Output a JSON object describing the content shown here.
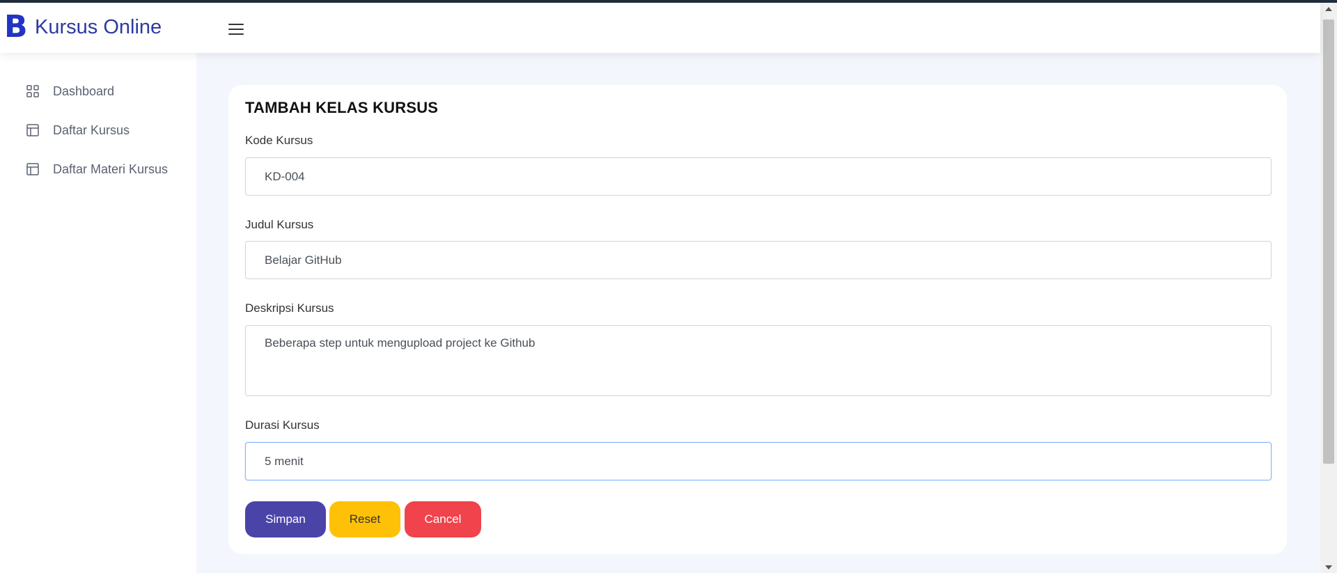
{
  "app": {
    "logo_letter": "B",
    "title": "Kursus Online",
    "menu_icon": "hamburger-menu-icon"
  },
  "sidebar": {
    "items": [
      {
        "label": "Dashboard",
        "icon": "grid-icon"
      },
      {
        "label": "Daftar Kursus",
        "icon": "layout-icon"
      },
      {
        "label": "Daftar Materi Kursus",
        "icon": "layout-icon"
      }
    ]
  },
  "form": {
    "title": "TAMBAH KELAS KURSUS",
    "fields": [
      {
        "label": "Kode Kursus",
        "value": "KD-004"
      },
      {
        "label": "Judul Kursus",
        "value": "Belajar GitHub"
      },
      {
        "label": "Deskripsi Kursus",
        "value": "Beberapa step untuk mengupload project ke Github"
      },
      {
        "label": "Durasi Kursus",
        "value": "5 menit"
      }
    ],
    "buttons": {
      "save": "Simpan",
      "reset": "Reset",
      "cancel": "Cancel"
    }
  },
  "colors": {
    "brand": "#2234c4",
    "save": "#4b44a8",
    "reset": "#ffc107",
    "cancel": "#f0434b",
    "background": "#f4f6fd"
  }
}
